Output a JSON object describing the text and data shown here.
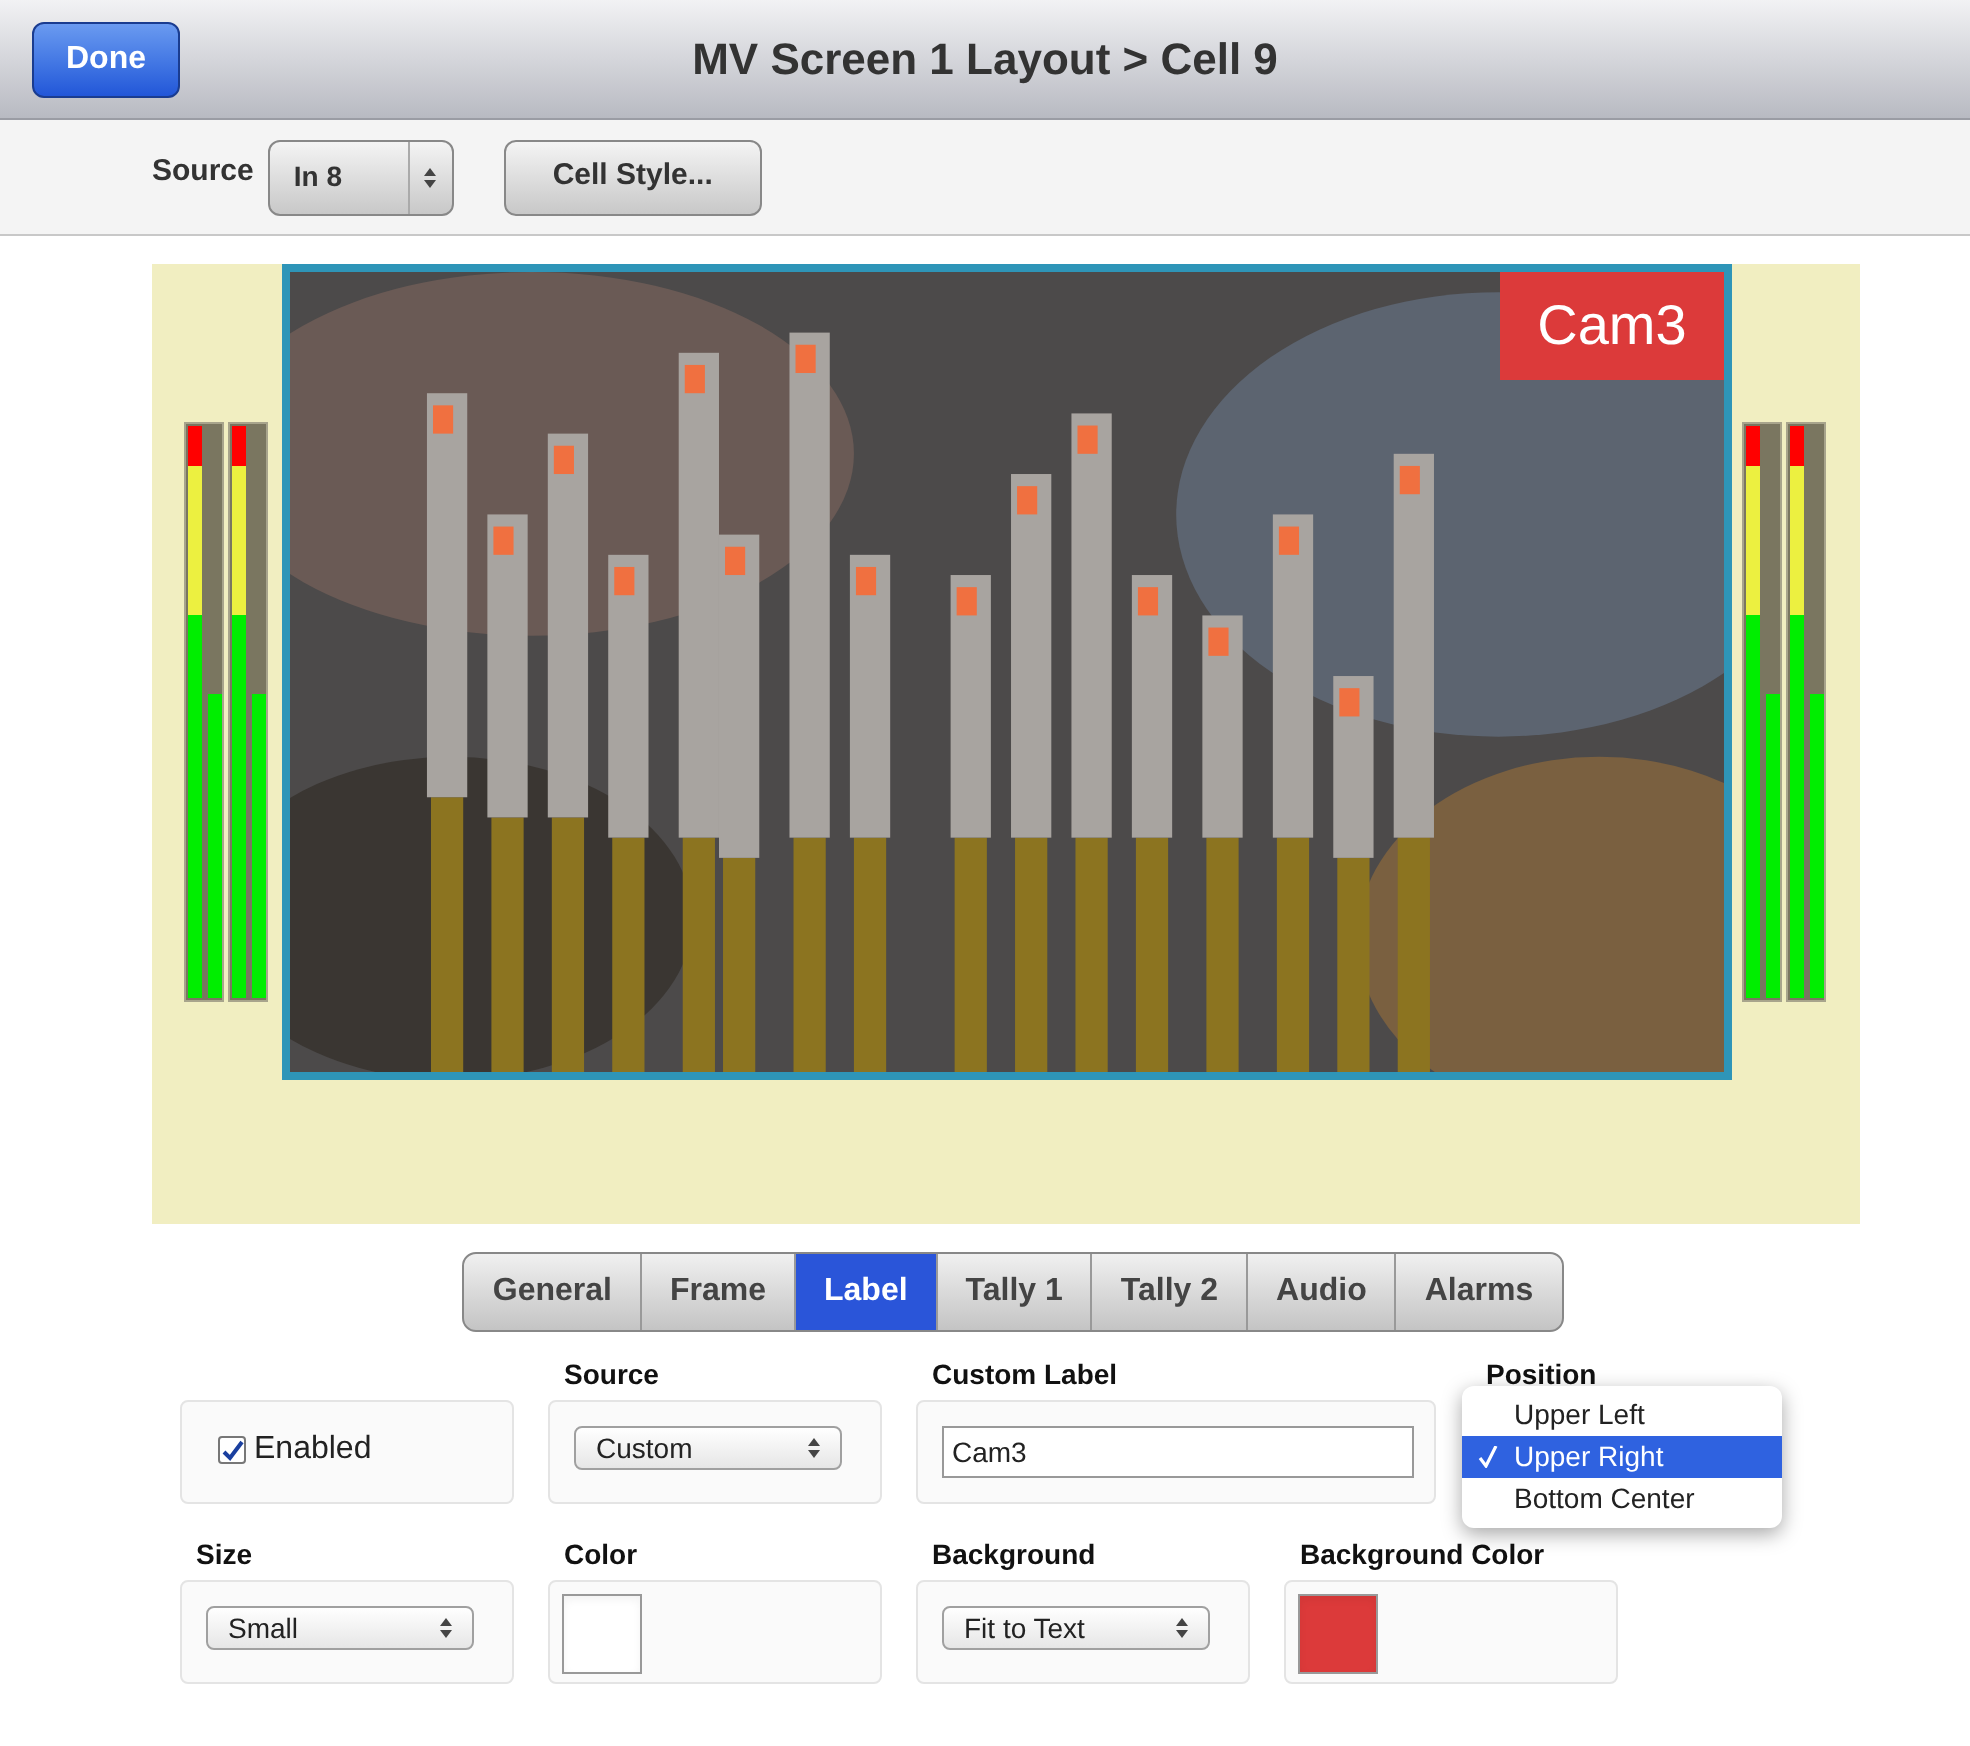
{
  "header": {
    "done_button": "Done",
    "title": "MV Screen 1 Layout > Cell 9"
  },
  "toolbar": {
    "source_label": "Source",
    "source_value": "In 8",
    "cell_style_button": "Cell Style..."
  },
  "preview": {
    "label": "Cam3",
    "left_meters": [
      {
        "channels": [
          {
            "level": 1
          },
          {
            "level": 0.53
          }
        ]
      },
      {
        "channels": [
          {
            "level": 1
          },
          {
            "level": 0.53
          }
        ]
      }
    ],
    "right_meters": [
      {
        "channels": [
          {
            "level": 1
          },
          {
            "level": 0.53
          }
        ]
      },
      {
        "channels": [
          {
            "level": 1
          },
          {
            "level": 0.53
          }
        ]
      }
    ]
  },
  "tabs": [
    {
      "label": "General",
      "selected": false
    },
    {
      "label": "Frame",
      "selected": false
    },
    {
      "label": "Label",
      "selected": true
    },
    {
      "label": "Tally 1",
      "selected": false
    },
    {
      "label": "Tally 2",
      "selected": false
    },
    {
      "label": "Audio",
      "selected": false
    },
    {
      "label": "Alarms",
      "selected": false
    }
  ],
  "fields_row_1": [
    {
      "kind": "checkbox",
      "label": "Enabled",
      "checked": true
    },
    {
      "kind": "select",
      "heading": "Source",
      "value": "Custom"
    },
    {
      "kind": "text",
      "heading": "Custom Label",
      "value": "Cam3"
    },
    {
      "kind": "menu",
      "heading": "Position",
      "options": [
        {
          "label": "Upper Left",
          "selected": false
        },
        {
          "label": "Upper Right",
          "selected": true
        },
        {
          "label": "Bottom Center",
          "selected": false
        }
      ]
    }
  ],
  "fields_row_2": [
    {
      "kind": "select",
      "heading": "Size",
      "value": "Small"
    },
    {
      "kind": "swatch",
      "heading": "Color",
      "color": "#ffffff"
    },
    {
      "kind": "select",
      "heading": "Background",
      "value": "Fit to Text"
    },
    {
      "kind": "swatch",
      "heading": "Background Color",
      "color": "#dc3a3a"
    }
  ]
}
